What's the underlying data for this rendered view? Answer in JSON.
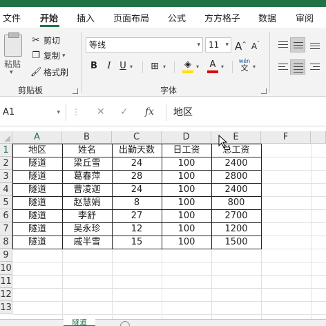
{
  "tabs": [
    "文件",
    "开始",
    "插入",
    "页面布局",
    "公式",
    "方方格子",
    "数据",
    "审阅"
  ],
  "active_tab": "开始",
  "clipboard": {
    "paste_label": "粘贴",
    "cut_label": "剪切",
    "copy_label": "复制",
    "format_painter_label": "格式刷",
    "group_label": "剪贴板"
  },
  "font": {
    "name": "等线",
    "size": "11",
    "group_label": "字体",
    "bold": "B",
    "italic": "I",
    "underline": "U",
    "grow": "A",
    "shrink": "A",
    "wen_top": "wén",
    "wen_bottom": "文",
    "fill_color": "#ffe000",
    "font_color": "#e00000"
  },
  "formula_bar": {
    "name_box": "A1",
    "content": "地区",
    "cancel": "✕",
    "enter": "✓",
    "fx": "fx"
  },
  "columns": [
    "A",
    "B",
    "C",
    "D",
    "E",
    "F"
  ],
  "rows": [
    "1",
    "2",
    "3",
    "4",
    "5",
    "6",
    "7",
    "8",
    "9",
    "10",
    "11",
    "12",
    "13"
  ],
  "table": {
    "headers": [
      "地区",
      "姓名",
      "出勤天数",
      "日工资",
      "总工资"
    ],
    "rows": [
      [
        "隧道",
        "梁丘雪",
        "24",
        "100",
        "2400"
      ],
      [
        "隧道",
        "葛春萍",
        "28",
        "100",
        "2800"
      ],
      [
        "隧道",
        "曹凌迦",
        "24",
        "100",
        "2400"
      ],
      [
        "隧道",
        "赵慧娟",
        "8",
        "100",
        "800"
      ],
      [
        "隧道",
        "李舒",
        "27",
        "100",
        "2700"
      ],
      [
        "隧道",
        "吴永珍",
        "12",
        "100",
        "1200"
      ],
      [
        "隧道",
        "戚半雪",
        "15",
        "100",
        "1500"
      ]
    ]
  },
  "sheet_tab": "隧道"
}
